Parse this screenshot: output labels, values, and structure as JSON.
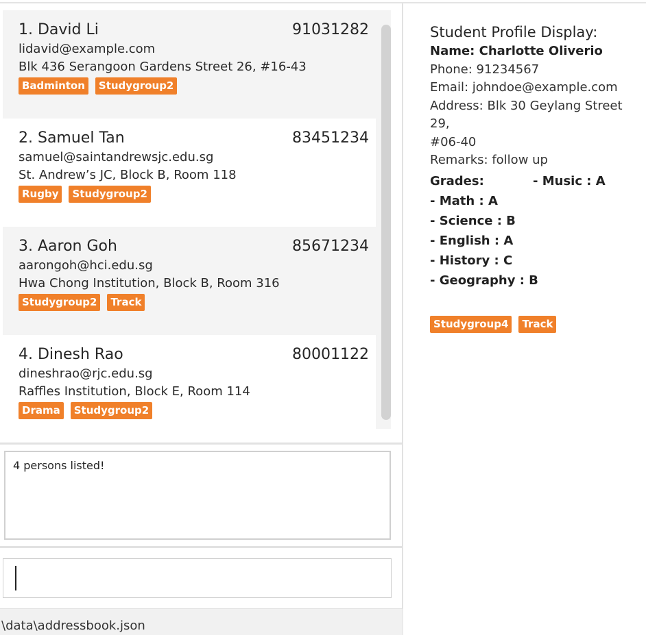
{
  "persons": [
    {
      "index_name": "1. David Li",
      "phone": "91031282",
      "email": "lidavid@example.com",
      "address": "Blk 436 Serangoon Gardens Street 26, #16-43",
      "tags": [
        "Badminton",
        "Studygroup2"
      ]
    },
    {
      "index_name": "2. Samuel Tan",
      "phone": "83451234",
      "email": "samuel@saintandrewsjc.edu.sg",
      "address": "St. Andrew’s JC, Block B, Room 118",
      "tags": [
        "Rugby",
        "Studygroup2"
      ]
    },
    {
      "index_name": "3. Aaron Goh",
      "phone": "85671234",
      "email": "aarongoh@hci.edu.sg",
      "address": "Hwa Chong Institution, Block B, Room 316",
      "tags": [
        "Studygroup2",
        "Track"
      ]
    },
    {
      "index_name": "4. Dinesh Rao",
      "phone": "80001122",
      "email": "dineshrao@rjc.edu.sg",
      "address": "Raffles Institution, Block E, Room 114",
      "tags": [
        "Drama",
        "Studygroup2"
      ]
    }
  ],
  "result": {
    "message": "4 persons listed!"
  },
  "command": {
    "value": ""
  },
  "status": {
    "path": "\\data\\addressbook.json"
  },
  "profile": {
    "title": "Student Profile Display:",
    "name": "Name: Charlotte Oliverio",
    "phone": "Phone: 91234567",
    "email": "Email: johndoe@example.com",
    "address_line1": "Address: Blk 30 Geylang Street 29,",
    "address_line2": "#06-40",
    "remarks": "Remarks: follow up",
    "grades_label": "Grades:",
    "grades": [
      "- Math : A",
      "- Science : B",
      "- English : A",
      "- History : C",
      "- Geography : B"
    ],
    "grades_side": "- Music : A",
    "tags": [
      "Studygroup4",
      "Track"
    ]
  },
  "colors": {
    "tag": "#f0802a",
    "panel": "#f4f4f4"
  }
}
